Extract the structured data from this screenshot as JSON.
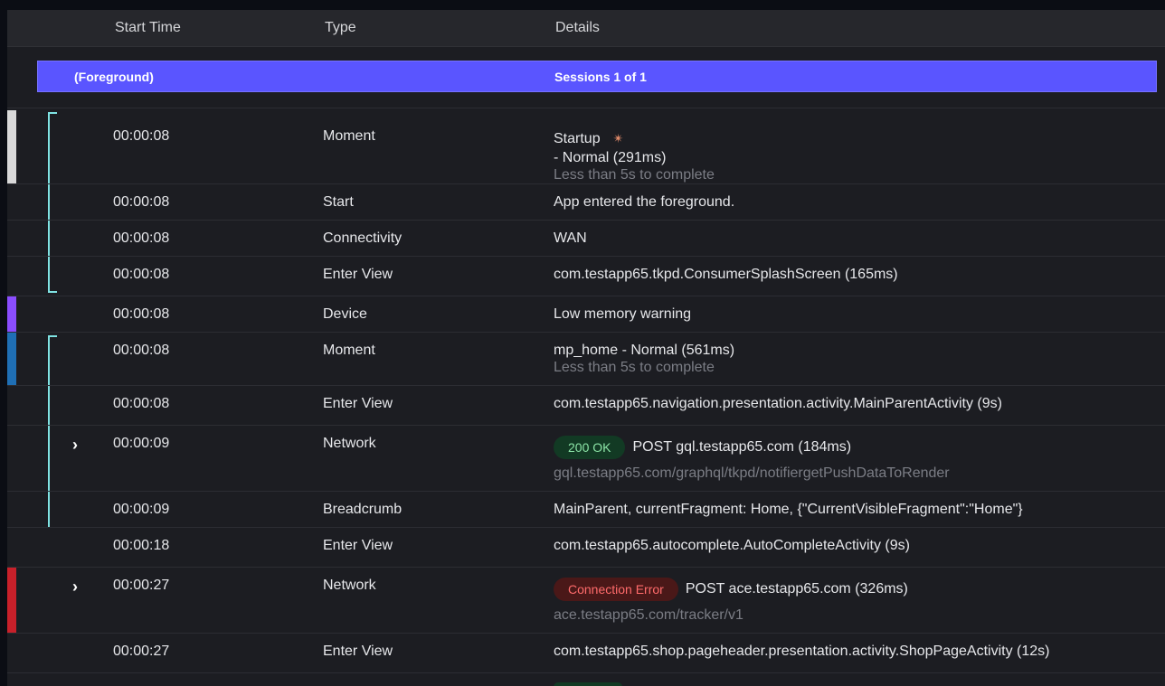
{
  "header": {
    "start_time": "Start Time",
    "type": "Type",
    "details": "Details"
  },
  "banner": {
    "left": "(Foreground)",
    "right": "Sessions 1 of 1"
  },
  "rows": [
    {
      "time": "00:00:08",
      "type": "Moment",
      "detail": "Startup",
      "detail2": "- Normal (291ms)",
      "sub": "Less than 5s to complete"
    },
    {
      "time": "00:00:08",
      "type": "Start",
      "detail": "App entered the foreground."
    },
    {
      "time": "00:00:08",
      "type": "Connectivity",
      "detail": "WAN"
    },
    {
      "time": "00:00:08",
      "type": "Enter View",
      "detail": "com.testapp65.tkpd.ConsumerSplashScreen (165ms)"
    },
    {
      "time": "00:00:08",
      "type": "Device",
      "detail": "Low memory warning"
    },
    {
      "time": "00:00:08",
      "type": "Moment",
      "detail": "mp_home - Normal (561ms)",
      "sub": "Less than 5s to complete"
    },
    {
      "time": "00:00:08",
      "type": "Enter View",
      "detail": "com.testapp65.navigation.presentation.activity.MainParentActivity (9s)"
    },
    {
      "time": "00:00:09",
      "type": "Network",
      "badge": "200 OK",
      "detail": "POST gql.testapp65.com (184ms)",
      "sub": "gql.testapp65.com/graphql/tkpd/notifiergetPushDataToRender"
    },
    {
      "time": "00:00:09",
      "type": "Breadcrumb",
      "detail": "MainParent, currentFragment: Home, {\"CurrentVisibleFragment\":\"Home\"}"
    },
    {
      "time": "00:00:18",
      "type": "Enter View",
      "detail": "com.testapp65.autocomplete.AutoCompleteActivity (9s)"
    },
    {
      "time": "00:00:27",
      "type": "Network",
      "badge": "Connection Error",
      "detail": "POST ace.testapp65.com (326ms)",
      "sub": "ace.testapp65.com/tracker/v1"
    },
    {
      "time": "00:00:27",
      "type": "Enter View",
      "detail": "com.testapp65.shop.pageheader.presentation.activity.ShopPageActivity (12s)"
    }
  ],
  "colors": {
    "banner": "#5a55ff",
    "marker_startup": "#d9d9d9",
    "marker_device": "#8b4dff",
    "marker_moment": "#1f6fb5",
    "marker_error": "#c8202a",
    "bracket": "#7fe3e3",
    "badge_ok_bg": "#123a24",
    "badge_err_bg": "#4a1818"
  },
  "icons": {
    "startup": "startup-sparkle-icon",
    "expand": "chevron-right-icon"
  }
}
